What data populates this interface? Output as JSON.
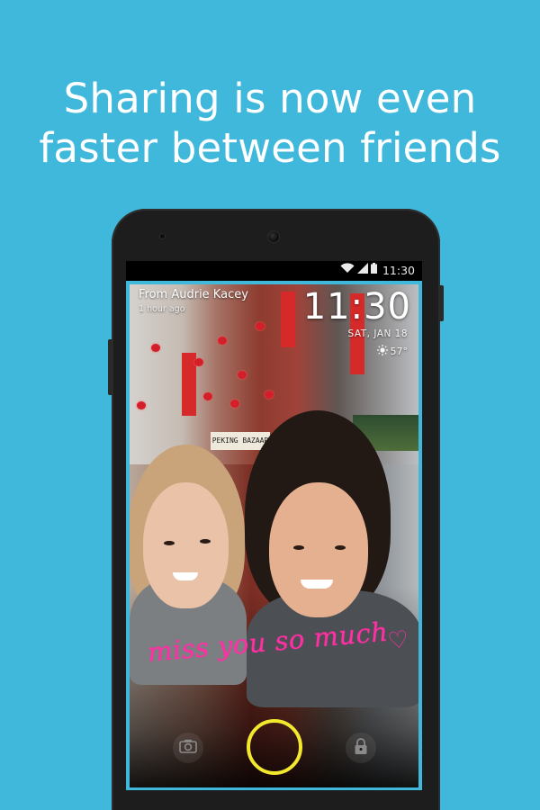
{
  "headline": {
    "line1": "Sharing is now even",
    "line2": "faster between friends"
  },
  "status_bar": {
    "time": "11:30",
    "icons": [
      "wifi-icon",
      "signal-icon",
      "battery-icon"
    ]
  },
  "lockscreen": {
    "from_label": "From Audrie Kacey",
    "time_ago": "1 hour ago",
    "clock": "11:30",
    "date": "SAT, JAN 18",
    "temperature": "57°",
    "weather_icon": "sun-icon"
  },
  "photo": {
    "shop_sign": "PEKING BAZAAR",
    "handwritten_message": "miss you so much",
    "message_color": "#ff2fa4"
  },
  "controls": {
    "camera_icon": "camera-icon",
    "shutter_color": "#f2e82d",
    "lock_icon": "lock-icon"
  },
  "colors": {
    "background": "#3fb8dc",
    "frame_accent": "#3fb8dc",
    "headline_text": "#ffffff"
  }
}
